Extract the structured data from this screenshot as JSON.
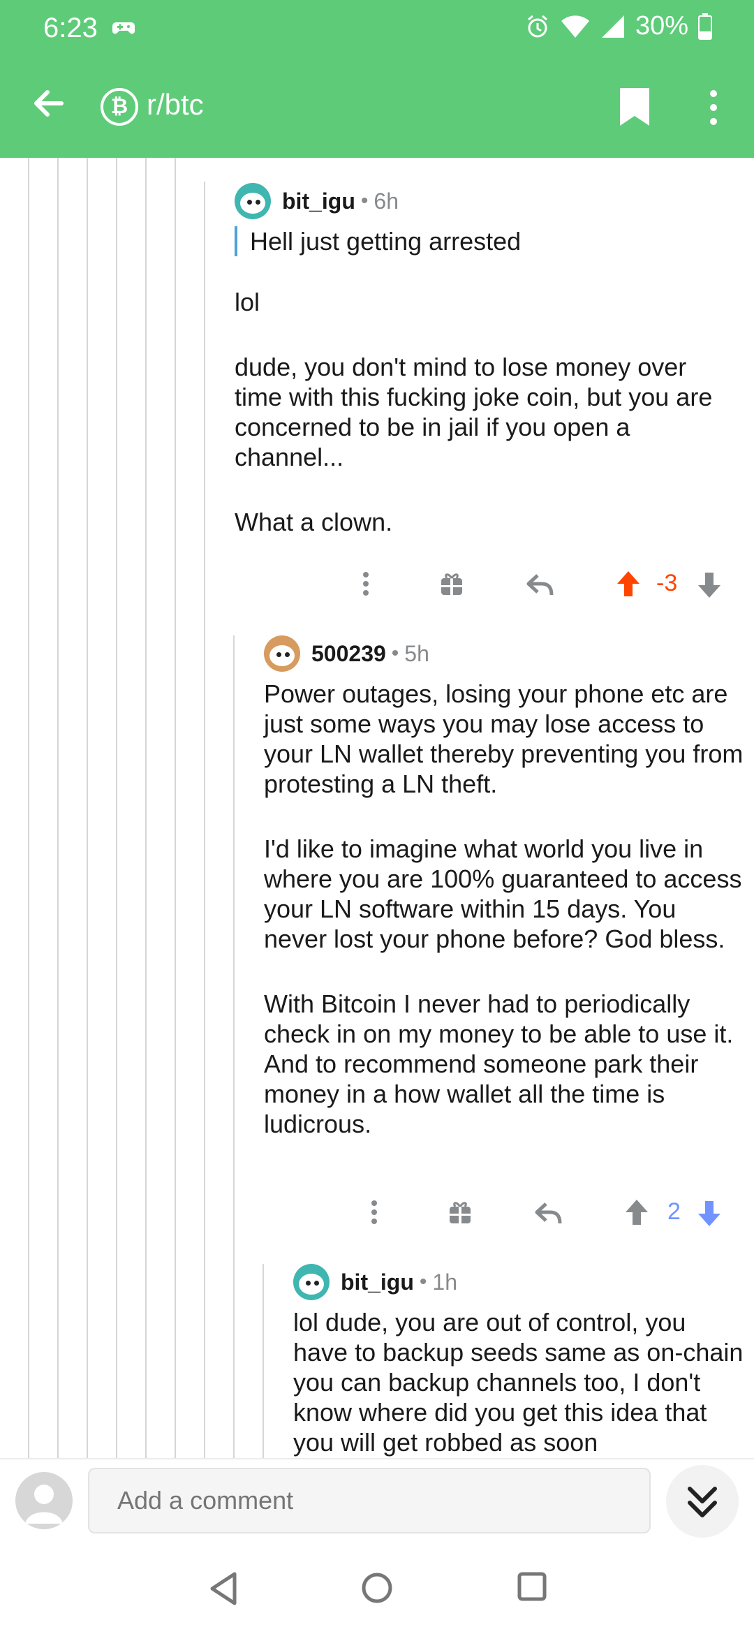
{
  "status_bar": {
    "time": "6:23",
    "battery": "30%"
  },
  "app_bar": {
    "subreddit": "r/btc",
    "subreddit_icon": "₿"
  },
  "comments": [
    {
      "author": "bit_igu",
      "age": "6h",
      "quote": "Hell just getting arrested",
      "paragraphs": [
        "lol",
        "dude, you don't mind to lose money over time with this fucking joke coin, but you are concerned to be in jail if you open a channel...",
        "What a clown."
      ],
      "score": "-3",
      "vote": "up"
    },
    {
      "author": "500239",
      "age": "5h",
      "paragraphs": [
        "Power outages, losing your phone etc are just some ways you may lose access to your LN wallet thereby preventing you from protesting a LN theft.",
        "I'd like to imagine what world you live in where you are 100% guaranteed to access your LN software within 15 days. You never lost your phone before? God bless.",
        "With Bitcoin I never had to periodically check in on my money to be able to use it. And to recommend someone park their money in a how wallet all the time is ludicrous."
      ],
      "score": "2",
      "vote": "down"
    },
    {
      "author": "bit_igu",
      "age": "1h",
      "paragraphs": [
        "lol dude, you are out of control, you have to backup seeds  same as on-chain you can backup channels  too, I don't know where did you get this idea that you will get robbed as soon"
      ]
    }
  ],
  "composer": {
    "placeholder": "Add a comment"
  },
  "colors": {
    "accent": "#5ecb79",
    "upvote": "#ff4500",
    "downvote": "#7193ff",
    "quote_bar": "#4fa0d8"
  }
}
